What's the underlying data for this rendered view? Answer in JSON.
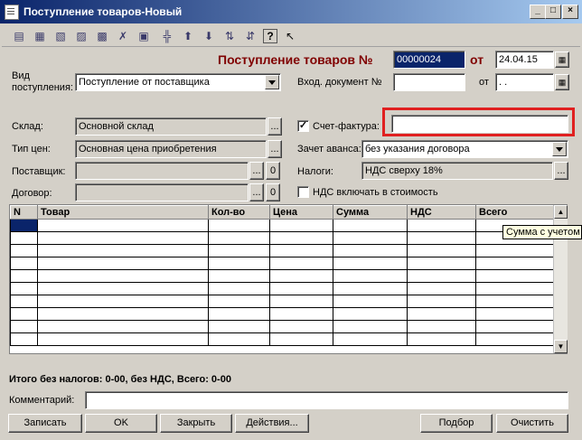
{
  "window": {
    "title": "Поступление товаров-Новый",
    "min_glyph": "_",
    "max_glyph": "□",
    "close_glyph": "×"
  },
  "toolbar": {
    "icons": [
      "form-icon",
      "add-row-icon",
      "copy-row-icon",
      "edit-row-icon",
      "delete-row-icon",
      "mark-delete-icon",
      "end-edit-icon",
      "separator",
      "move-up-icon",
      "move-down-icon",
      "sort-asc-icon",
      "sort-desc-icon",
      "help-icon",
      "whats-this-icon"
    ]
  },
  "header": {
    "doc_title": "Поступление товаров №",
    "number": "00000024",
    "ot": "от",
    "date": "24.04.15"
  },
  "form": {
    "vid_label_1": "Вид",
    "vid_label_2": "поступления:",
    "vid_value": "Поступление от поставщика",
    "vhod_doc_label": "Вход. документ №",
    "vhod_doc_value": "",
    "vhod_ot_label": "от",
    "vhod_date_value": " .  .",
    "sklad_label": "Склад:",
    "sklad_value": "Основной склад",
    "schet_label": "Счет-фактура:",
    "schet_checked": "✓",
    "schet_value": "",
    "tip_cen_label": "Тип цен:",
    "tip_cen_value": "Основная цена приобретения",
    "zachet_label": "Зачет аванса:",
    "zachet_value": "без указания договора",
    "postavshik_label": "Поставщик:",
    "postavshik_value": "",
    "nalogi_label": "Налоги:",
    "nalogi_value": "НДС сверху 18%",
    "dogovor_label": "Договор:",
    "dogovor_value": "",
    "nds_include_label": "НДС включать в стоимость",
    "ellipsis": "...",
    "zero": "0"
  },
  "table": {
    "columns": [
      "N",
      "Товар",
      "Кол-во",
      "Цена",
      "Сумма",
      "НДС",
      "Всего"
    ],
    "row_count": 10
  },
  "tooltip": "Сумма с учетом налогов",
  "totals": "Итого без налогов: 0-00, без НДС, Всего: 0-00",
  "comment_label": "Комментарий:",
  "comment_value": "",
  "buttons": {
    "write": "Записать",
    "ok": "OK",
    "close": "Закрыть",
    "actions": "Действия...",
    "select": "Подбор",
    "clear": "Очистить"
  }
}
